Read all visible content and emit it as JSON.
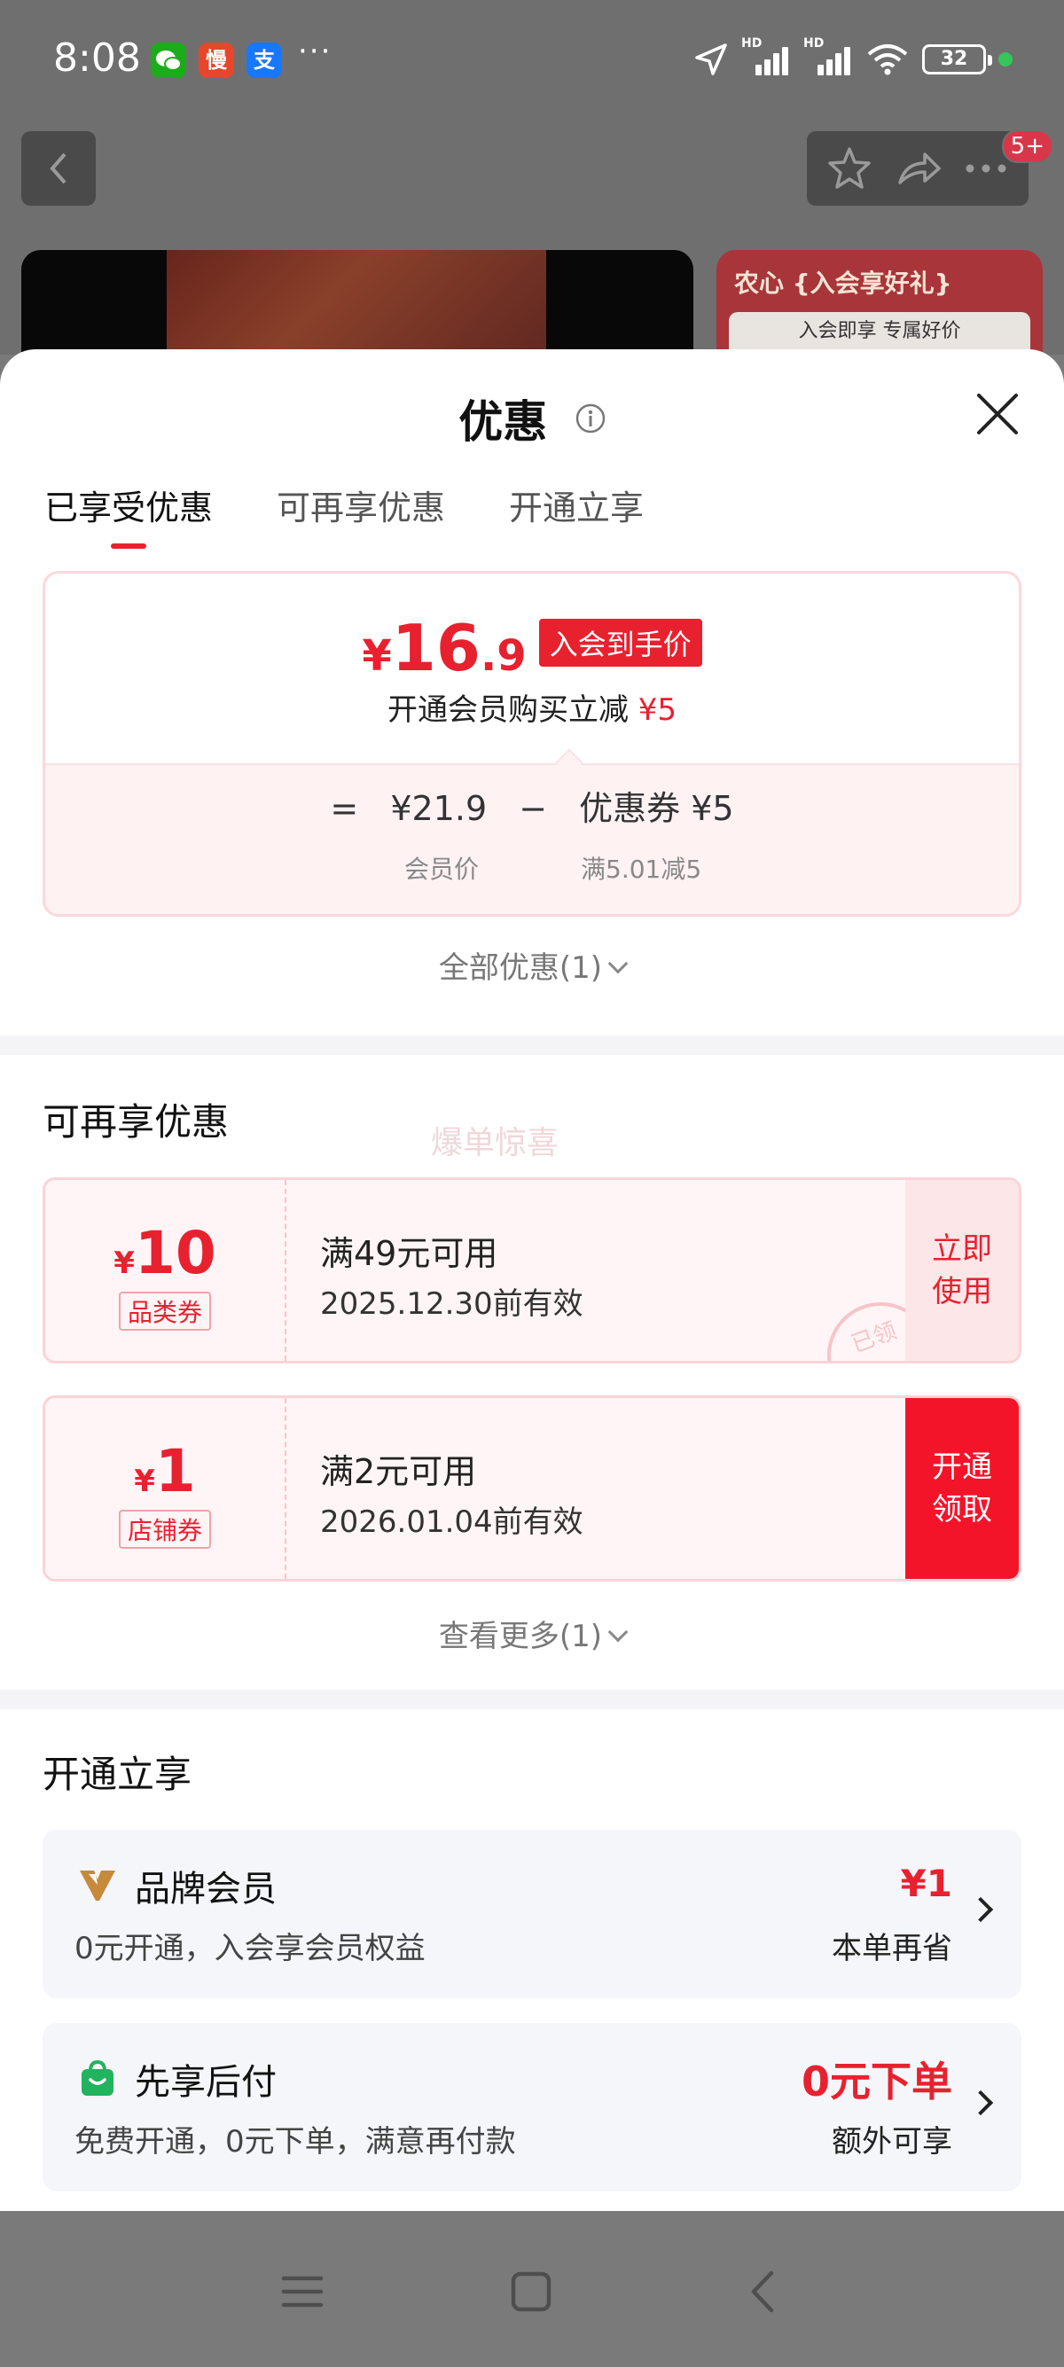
{
  "status_bar": {
    "time": "8:08",
    "apps": [
      {
        "icon": "wechat-icon",
        "glyph": "",
        "color": "#1aad19"
      },
      {
        "icon": "manman-icon",
        "glyph": "慢",
        "color": "#e8462a"
      },
      {
        "icon": "alipay-icon",
        "glyph": "支",
        "color": "#1677ff"
      }
    ],
    "more": "···",
    "signal_label": "HD",
    "battery": "32"
  },
  "backdrop": {
    "badge": "5+",
    "promo_title": "农心 {入会享好礼}",
    "promo_sub": "入会即享 专属好价"
  },
  "sheet": {
    "title": "优惠",
    "tabs": [
      "已享受优惠",
      "可再享优惠",
      "开通立享"
    ],
    "active_tab": 0,
    "price_card": {
      "currency": "¥",
      "price_int": "16",
      "price_dec": ".9",
      "tag": "入会到手价",
      "subtitle": "开通会员购买立减",
      "subtitle_amount": "¥5",
      "equation": {
        "eq": "=",
        "member_price": "¥21.9",
        "minus": "−",
        "coupon": "优惠券 ¥5",
        "member_caption": "会员价",
        "coupon_caption": "满5.01减5"
      }
    },
    "all_discounts": "全部优惠(1)",
    "more_section": {
      "title": "可再享优惠",
      "watermark": "爆单惊喜",
      "coupons": [
        {
          "currency": "¥",
          "amount": "10",
          "type": "品类券",
          "condition": "满49元可用",
          "expiry": "2025.12.30前有效",
          "action_line1": "立即",
          "action_line2": "使用",
          "stamp": "已领"
        },
        {
          "currency": "¥",
          "amount": "1",
          "type": "店铺券",
          "condition": "满2元可用",
          "expiry": "2026.01.04前有效",
          "action_line1": "开通",
          "action_line2": "领取"
        }
      ],
      "see_more": "查看更多(1)"
    },
    "open_section": {
      "title": "开通立享",
      "items": [
        {
          "icon": "brand-member-icon",
          "name": "品牌会员",
          "desc": "0元开通，入会享会员权益",
          "right_top": "¥1",
          "right_bottom": "本单再省"
        },
        {
          "icon": "shopping-bag-icon",
          "name": "先享后付",
          "desc": "免费开通，0元下单，满意再付款",
          "right_top": "0元下单",
          "right_bottom": "额外可享"
        }
      ]
    }
  },
  "colors": {
    "accent": "#e8212f",
    "solid_button": "#f4142a",
    "card_border": "#fad3d7"
  }
}
